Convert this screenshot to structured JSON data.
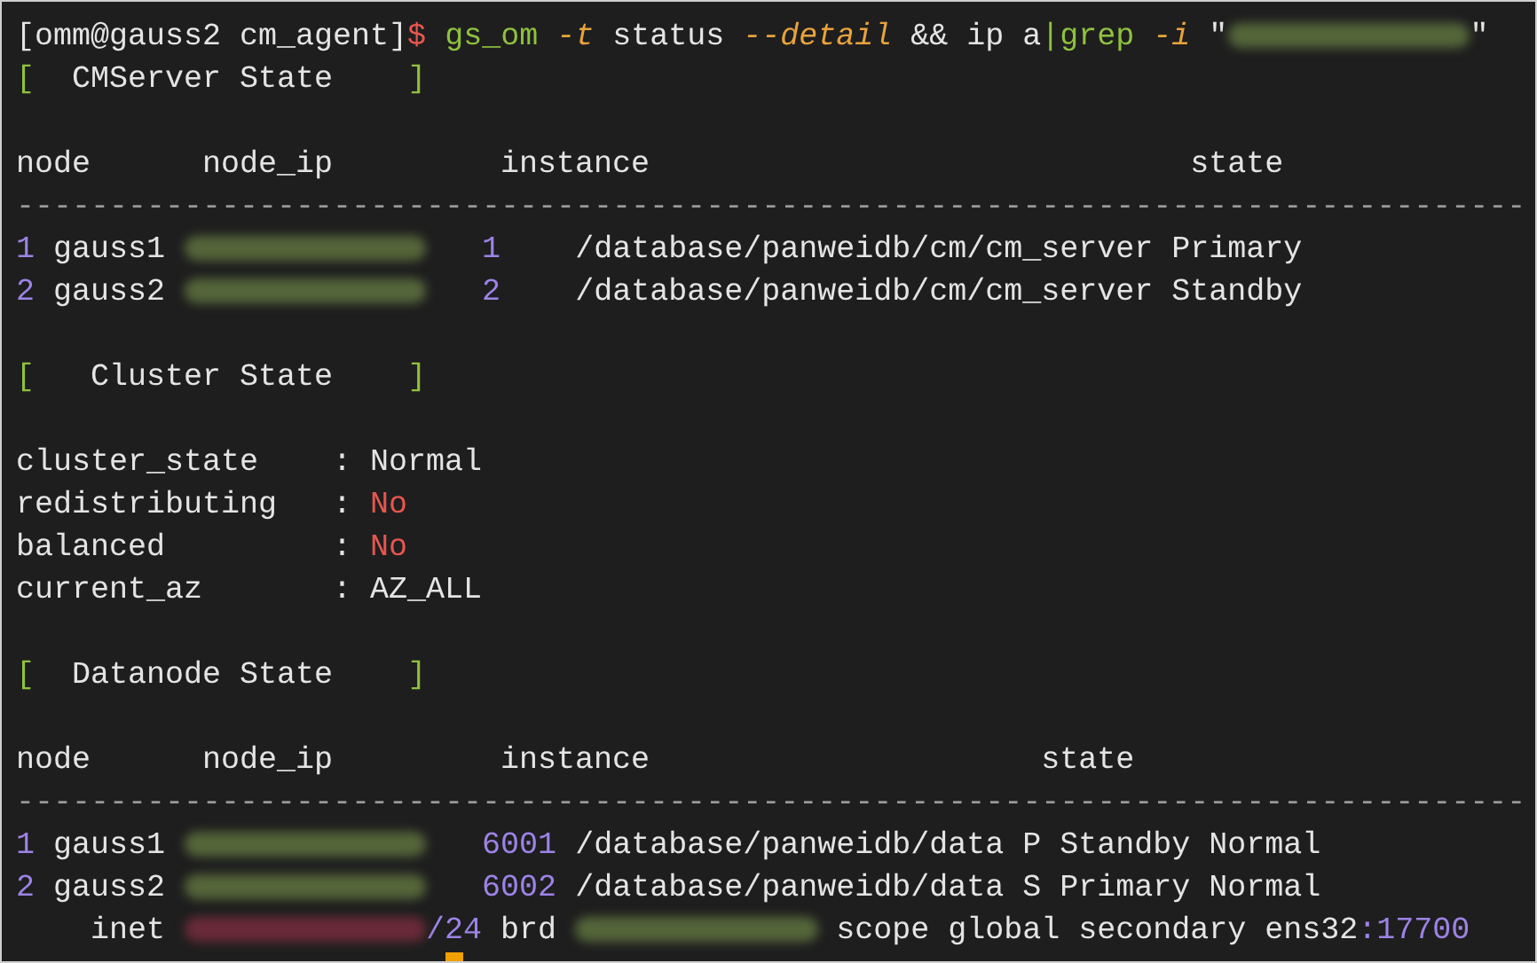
{
  "terminal": {
    "lines": [
      {
        "kind": "text",
        "segments": [
          {
            "text": "[omm@gauss2 cm_agent]",
            "kind": "plain"
          },
          {
            "text": "$ ",
            "kind": "red"
          },
          {
            "text": "gs_om ",
            "kind": "green"
          },
          {
            "text": "-t",
            "kind": "option"
          },
          {
            "text": " status ",
            "kind": "plain"
          },
          {
            "text": "--detail",
            "kind": "option"
          },
          {
            "text": " && ip a",
            "kind": "plain"
          },
          {
            "text": "|grep ",
            "kind": "green"
          },
          {
            "text": "-i",
            "kind": "option"
          },
          {
            "text": " \"",
            "kind": "plain"
          },
          {
            "kind": "redacted"
          },
          {
            "text": "\"",
            "kind": "plain"
          }
        ]
      },
      {
        "kind": "text",
        "segments": [
          {
            "text": "[",
            "kind": "green"
          },
          {
            "text": "  CMServer State    ",
            "kind": "plain"
          },
          {
            "text": "]",
            "kind": "green"
          }
        ]
      },
      {
        "kind": "blank"
      },
      {
        "kind": "text",
        "segments": [
          {
            "text": "node      node_ip         instance                             state",
            "kind": "plain"
          }
        ]
      },
      {
        "kind": "text",
        "segments": [
          {
            "text": "---------------------------------------------------------------------------------",
            "kind": "rule"
          }
        ]
      },
      {
        "kind": "text",
        "segments": [
          {
            "text": "1",
            "kind": "number"
          },
          {
            "text": " gauss1 ",
            "kind": "plain"
          },
          {
            "kind": "redacted"
          },
          {
            "text": "   1",
            "kind": "number"
          },
          {
            "text": "    /database/panweidb/cm/cm_server Primary",
            "kind": "plain"
          }
        ]
      },
      {
        "kind": "text",
        "segments": [
          {
            "text": "2",
            "kind": "number"
          },
          {
            "text": " gauss2 ",
            "kind": "plain"
          },
          {
            "kind": "redacted"
          },
          {
            "text": "   2",
            "kind": "number"
          },
          {
            "text": "    /database/panweidb/cm/cm_server Standby",
            "kind": "plain"
          }
        ]
      },
      {
        "kind": "blank"
      },
      {
        "kind": "text",
        "segments": [
          {
            "text": "[",
            "kind": "green"
          },
          {
            "text": "   Cluster State    ",
            "kind": "plain"
          },
          {
            "text": "]",
            "kind": "green"
          }
        ]
      },
      {
        "kind": "blank"
      },
      {
        "kind": "text",
        "segments": [
          {
            "text": "cluster_state    : Normal",
            "kind": "plain"
          }
        ]
      },
      {
        "kind": "text",
        "segments": [
          {
            "text": "redistributing   : ",
            "kind": "plain"
          },
          {
            "text": "No",
            "kind": "red"
          }
        ]
      },
      {
        "kind": "text",
        "segments": [
          {
            "text": "balanced         : ",
            "kind": "plain"
          },
          {
            "text": "No",
            "kind": "red"
          }
        ]
      },
      {
        "kind": "text",
        "segments": [
          {
            "text": "current_az       : AZ_ALL",
            "kind": "plain"
          }
        ]
      },
      {
        "kind": "blank"
      },
      {
        "kind": "text",
        "segments": [
          {
            "text": "[",
            "kind": "green"
          },
          {
            "text": "  Datanode State    ",
            "kind": "plain"
          },
          {
            "text": "]",
            "kind": "green"
          }
        ]
      },
      {
        "kind": "blank"
      },
      {
        "kind": "text",
        "segments": [
          {
            "text": "node      node_ip         instance                     state",
            "kind": "plain"
          }
        ]
      },
      {
        "kind": "text",
        "segments": [
          {
            "text": "---------------------------------------------------------------------------------",
            "kind": "rule"
          }
        ]
      },
      {
        "kind": "text",
        "segments": [
          {
            "text": "1",
            "kind": "number"
          },
          {
            "text": " gauss1 ",
            "kind": "plain"
          },
          {
            "kind": "redacted"
          },
          {
            "text": "   6001",
            "kind": "number"
          },
          {
            "text": " /database/panweidb/data P Standby Normal",
            "kind": "plain"
          }
        ]
      },
      {
        "kind": "text",
        "segments": [
          {
            "text": "2",
            "kind": "number"
          },
          {
            "text": " gauss2 ",
            "kind": "plain"
          },
          {
            "kind": "redacted"
          },
          {
            "text": "   6002",
            "kind": "number"
          },
          {
            "text": " /database/panweidb/data S Primary Normal",
            "kind": "plain"
          }
        ]
      },
      {
        "kind": "text",
        "segments": [
          {
            "text": "    inet ",
            "kind": "plain"
          },
          {
            "kind": "redacted-red"
          },
          {
            "text": "/24",
            "kind": "number"
          },
          {
            "text": " brd ",
            "kind": "plain"
          },
          {
            "kind": "redacted"
          },
          {
            "text": " scope global secondary ens32",
            "kind": "plain"
          },
          {
            "text": ":17700",
            "kind": "number"
          }
        ]
      },
      {
        "kind": "cursor"
      }
    ]
  }
}
